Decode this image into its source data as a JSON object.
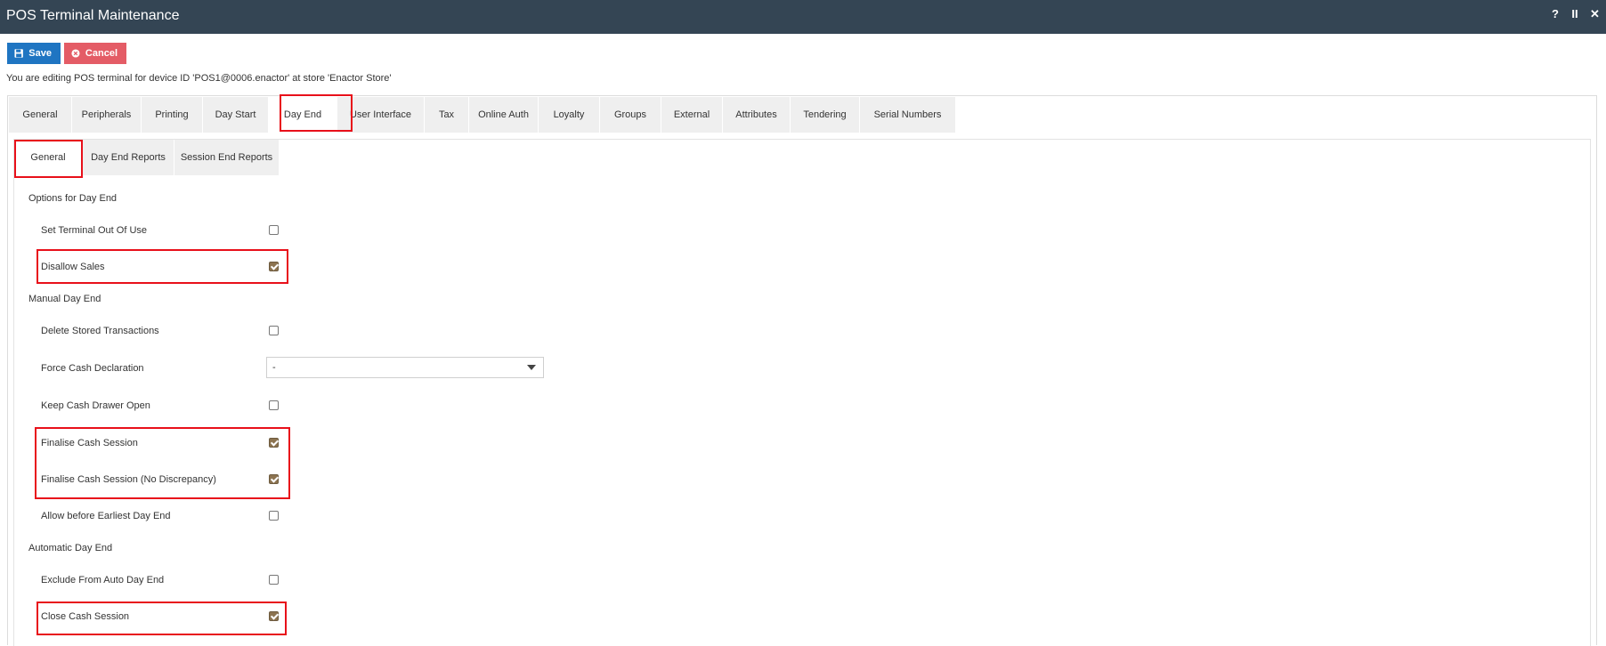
{
  "window": {
    "title": "POS Terminal Maintenance",
    "controls": [
      "?",
      "II",
      "✕"
    ]
  },
  "toolbar": {
    "save_label": "Save",
    "cancel_label": "Cancel"
  },
  "info_text": "You are editing POS terminal for device ID 'POS1@0006.enactor' at store 'Enactor Store'",
  "main_tabs": [
    "General",
    "Peripherals",
    "Printing",
    "Day Start",
    "Day End",
    "User Interface",
    "Tax",
    "Online Auth",
    "Loyalty",
    "Groups",
    "External",
    "Attributes",
    "Tendering",
    "Serial Numbers"
  ],
  "main_tabs_active": "Day End",
  "sub_tabs": [
    "General",
    "Day End Reports",
    "Session End Reports"
  ],
  "sub_tabs_active": "General",
  "sections": {
    "options_day_end": "Options for Day End",
    "manual_day_end": "Manual Day End",
    "automatic_day_end": "Automatic Day End"
  },
  "fields": {
    "set_terminal_out_of_use": {
      "label": "Set Terminal Out Of Use",
      "checked": false
    },
    "disallow_sales": {
      "label": "Disallow Sales",
      "checked": true
    },
    "delete_stored_transactions": {
      "label": "Delete Stored Transactions",
      "checked": false
    },
    "force_cash_declaration": {
      "label": "Force Cash Declaration",
      "value": "-"
    },
    "keep_cash_drawer_open": {
      "label": "Keep Cash Drawer Open",
      "checked": false
    },
    "finalise_cash_session": {
      "label": "Finalise Cash Session",
      "checked": true
    },
    "finalise_cash_session_no_discrepancy": {
      "label": "Finalise Cash Session (No Discrepancy)",
      "checked": true
    },
    "allow_before_earliest_day_end": {
      "label": "Allow before Earliest Day End",
      "checked": false
    },
    "exclude_from_auto_day_end": {
      "label": "Exclude From Auto Day End",
      "checked": false
    },
    "close_cash_session": {
      "label": "Close Cash Session",
      "checked": true
    }
  },
  "colors": {
    "titlebar": "#344554",
    "save": "#1f75c2",
    "cancel": "#e45c66",
    "checkbox_checked": "#8c7350",
    "highlight": "#e8101a"
  }
}
